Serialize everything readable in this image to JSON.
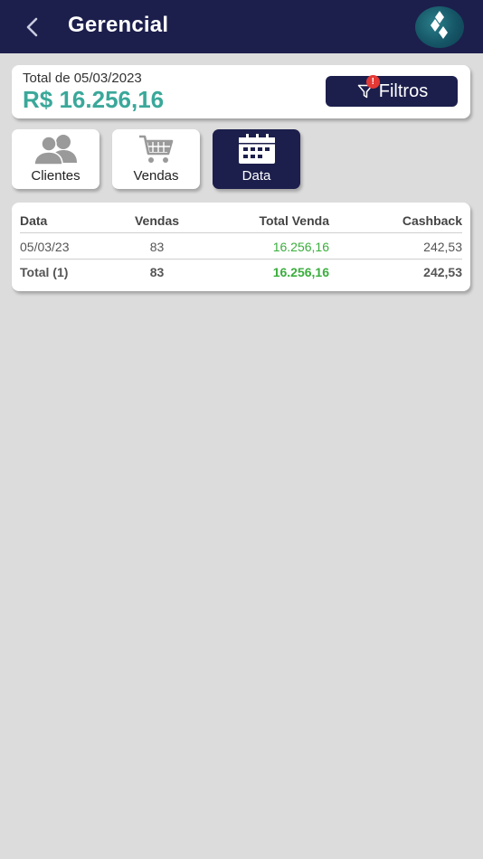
{
  "header": {
    "title": "Gerencial"
  },
  "summary": {
    "label": "Total de 05/03/2023",
    "value": "R$ 16.256,16",
    "filter_label": "Filtros",
    "filter_badge": "!"
  },
  "tabs": [
    {
      "label": "Clientes",
      "icon": "users-icon",
      "active": false
    },
    {
      "label": "Vendas",
      "icon": "cart-icon",
      "active": false
    },
    {
      "label": "Data",
      "icon": "calendar-icon",
      "active": true
    }
  ],
  "table": {
    "headers": [
      "Data",
      "Vendas",
      "Total Venda",
      "Cashback"
    ],
    "rows": [
      [
        "05/03/23",
        "83",
        "16.256,16",
        "242,53"
      ]
    ],
    "total": [
      "Total (1)",
      "83",
      "16.256,16",
      "242,53"
    ]
  },
  "colors": {
    "primary": "#1c1f4c",
    "accent_teal": "#3aa89a",
    "accent_green": "#3aae3c",
    "badge_red": "#e53935",
    "background": "#dcdcdc"
  }
}
